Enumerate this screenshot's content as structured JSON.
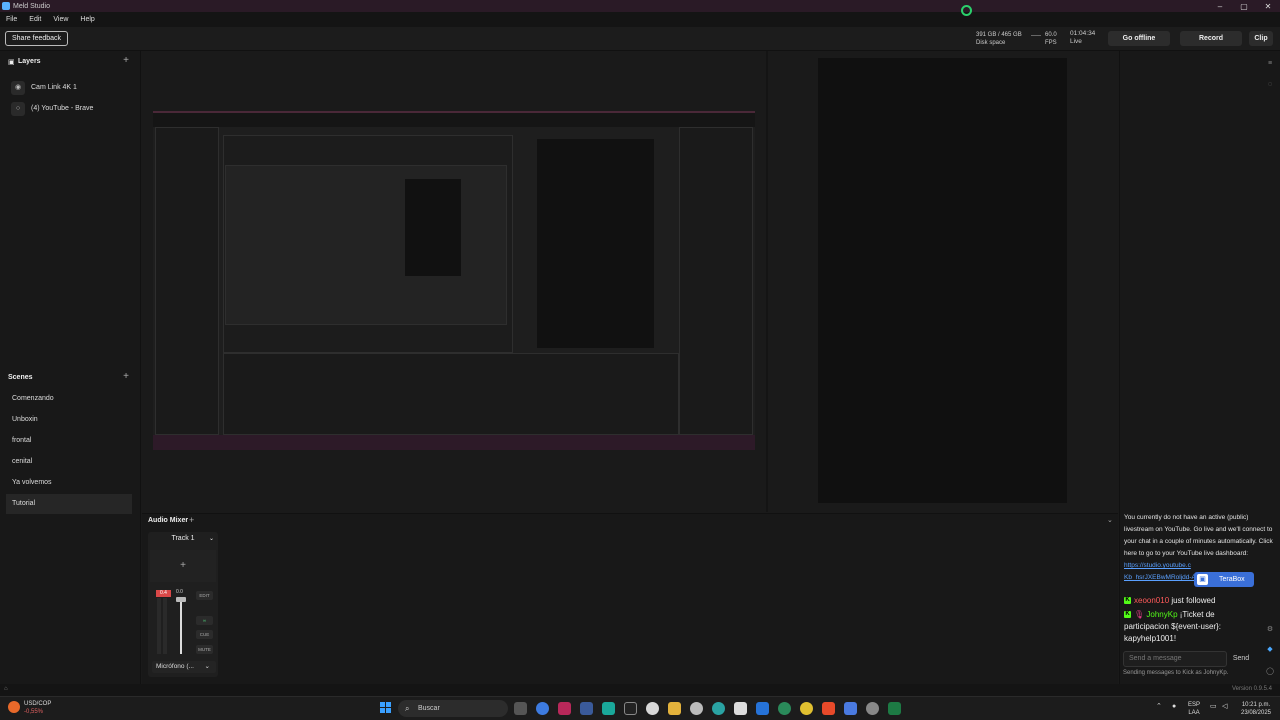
{
  "window": {
    "title": "Meld Studio"
  },
  "menu": [
    "File",
    "Edit",
    "View",
    "Help"
  ],
  "topbar": {
    "feedback": "Share feedback",
    "disk_value": "391 GB / 465 GB",
    "disk_label": "Disk space",
    "fps_value": "60.0",
    "fps_label": "FPS",
    "time_value": "01:04:34",
    "time_label": "Live",
    "go_offline": "Go offline",
    "record": "Record",
    "clip": "Clip"
  },
  "layers": {
    "title": "Layers",
    "items": [
      {
        "label": "Cam Link 4K 1"
      },
      {
        "label": "(4) YouTube - Brave"
      }
    ]
  },
  "scenes": {
    "title": "Scenes",
    "items": [
      "Comenzando",
      "Unboxin",
      "frontal",
      "cenital",
      "Ya volvemos",
      "Tutorial"
    ],
    "active": "Tutorial"
  },
  "mixer": {
    "title": "Audio Mixer",
    "track_name": "Track 1",
    "peak": "0.4",
    "level": "0.0",
    "btn_edit": "EDIT",
    "btn_cue": "CUE",
    "btn_mute": "MUTE",
    "device": "Micrófono (..."
  },
  "chat": {
    "notice": "You currently do not have an active (public) livestream on YouTube. Go live and we'll connect to your chat in a couple of minutes automatically. Click here to go to your YouTube live dashboard:",
    "link1": "https://studio.youtube.c",
    "link2": "Kb_hsrJXEBwMRoljdd-A",
    "terabox": "TeraBox",
    "msg1_user": "xeoon010",
    "msg1_text": "just followed",
    "msg2_user": "JohnyKp",
    "msg2_text": "¡Ticket de participacion ${event-user}: kapyhelp1001!",
    "input_placeholder": "Send a message",
    "send": "Send",
    "footer": "Sending messages to Kick as JohnyKp."
  },
  "status": {
    "version": "Version 0.9.5.4"
  },
  "taskbar": {
    "ticker_name": "USD/COP",
    "ticker_change": "-0,55%",
    "search": "Buscar",
    "lang1": "ESP",
    "lang2": "LAA",
    "time": "10:21 p.m.",
    "date": "23/08/2025"
  }
}
